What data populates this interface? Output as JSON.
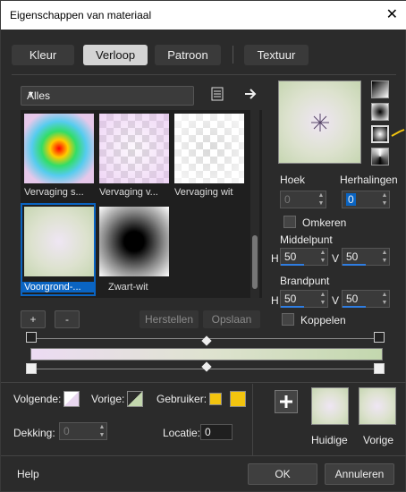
{
  "window": {
    "title": "Eigenschappen van materiaal",
    "close": "✕"
  },
  "tabs": [
    {
      "label": "Kleur"
    },
    {
      "label": "Verloop"
    },
    {
      "label": "Patroon"
    },
    {
      "label": "Textuur"
    }
  ],
  "filter": {
    "selected": "Alles"
  },
  "gallery": {
    "items": [
      {
        "label": "Vervaging s..."
      },
      {
        "label": "Vervaging v..."
      },
      {
        "label": "Vervaging wit"
      },
      {
        "label": "Voorgrond-..."
      },
      {
        "label": "Zwart-wit"
      }
    ]
  },
  "gallery_buttons": {
    "add": "+",
    "remove": "-",
    "reset": "Herstellen",
    "save": "Opslaan"
  },
  "props": {
    "angle_label": "Hoek",
    "angle_value": "0",
    "repeats_label": "Herhalingen",
    "repeats_value": "0",
    "invert_label": "Omkeren",
    "midpoint_label": "Middelpunt",
    "midpoint_h_label": "H",
    "midpoint_h": "50",
    "midpoint_v_label": "V",
    "midpoint_v": "50",
    "focus_label": "Brandpunt",
    "focus_h_label": "H",
    "focus_h": "50",
    "focus_v_label": "V",
    "focus_v": "50",
    "link_label": "Koppelen"
  },
  "bottom": {
    "next_label": "Volgende:",
    "prev_label": "Vorige:",
    "user_label": "Gebruiker:",
    "opacity_label": "Dekking:",
    "opacity_value": "0",
    "location_label": "Locatie:",
    "location_value": "0",
    "current_label": "Huidige",
    "previous_label": "Vorige"
  },
  "footer": {
    "help": "Help",
    "ok": "OK",
    "cancel": "Annuleren"
  },
  "colors": {
    "accent": "#0a64c2",
    "user_swatch": "#f2c40f"
  }
}
